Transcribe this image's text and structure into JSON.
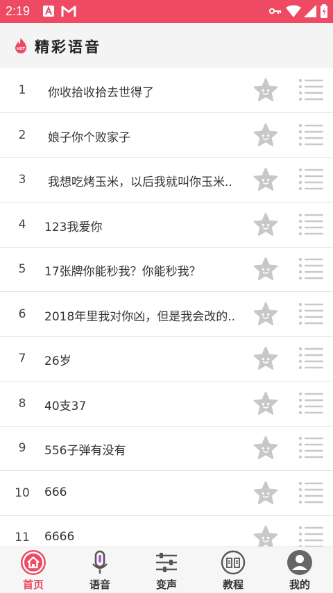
{
  "status_bar": {
    "time": "2:19"
  },
  "header": {
    "title": "精彩语音",
    "hot_badge": "HOT"
  },
  "list": [
    {
      "num": "1",
      "title": "你收拾收拾去世得了"
    },
    {
      "num": "2",
      "title": "娘子你个败家子"
    },
    {
      "num": "3",
      "title": "我想吃烤玉米，以后我就叫你玉米.."
    },
    {
      "num": "4",
      "title": "123我爱你"
    },
    {
      "num": "5",
      "title": "17张牌你能秒我？你能秒我？"
    },
    {
      "num": "6",
      "title": "2018年里我对你凶，但是我会改的.."
    },
    {
      "num": "7",
      "title": "26岁"
    },
    {
      "num": "8",
      "title": "40支37"
    },
    {
      "num": "9",
      "title": "556子弹有没有"
    },
    {
      "num": "10",
      "title": "666"
    },
    {
      "num": "11",
      "title": "6666"
    }
  ],
  "tabs": [
    {
      "label": "首页",
      "icon": "home-icon",
      "active": true
    },
    {
      "label": "语音",
      "icon": "microphone-icon",
      "active": false
    },
    {
      "label": "变声",
      "icon": "sliders-icon",
      "active": false
    },
    {
      "label": "教程",
      "icon": "book-icon",
      "active": false
    },
    {
      "label": "我的",
      "icon": "user-avatar-icon",
      "active": false
    }
  ],
  "colors": {
    "accent": "#ee4a64",
    "icon_gray": "#c8c8c8"
  }
}
